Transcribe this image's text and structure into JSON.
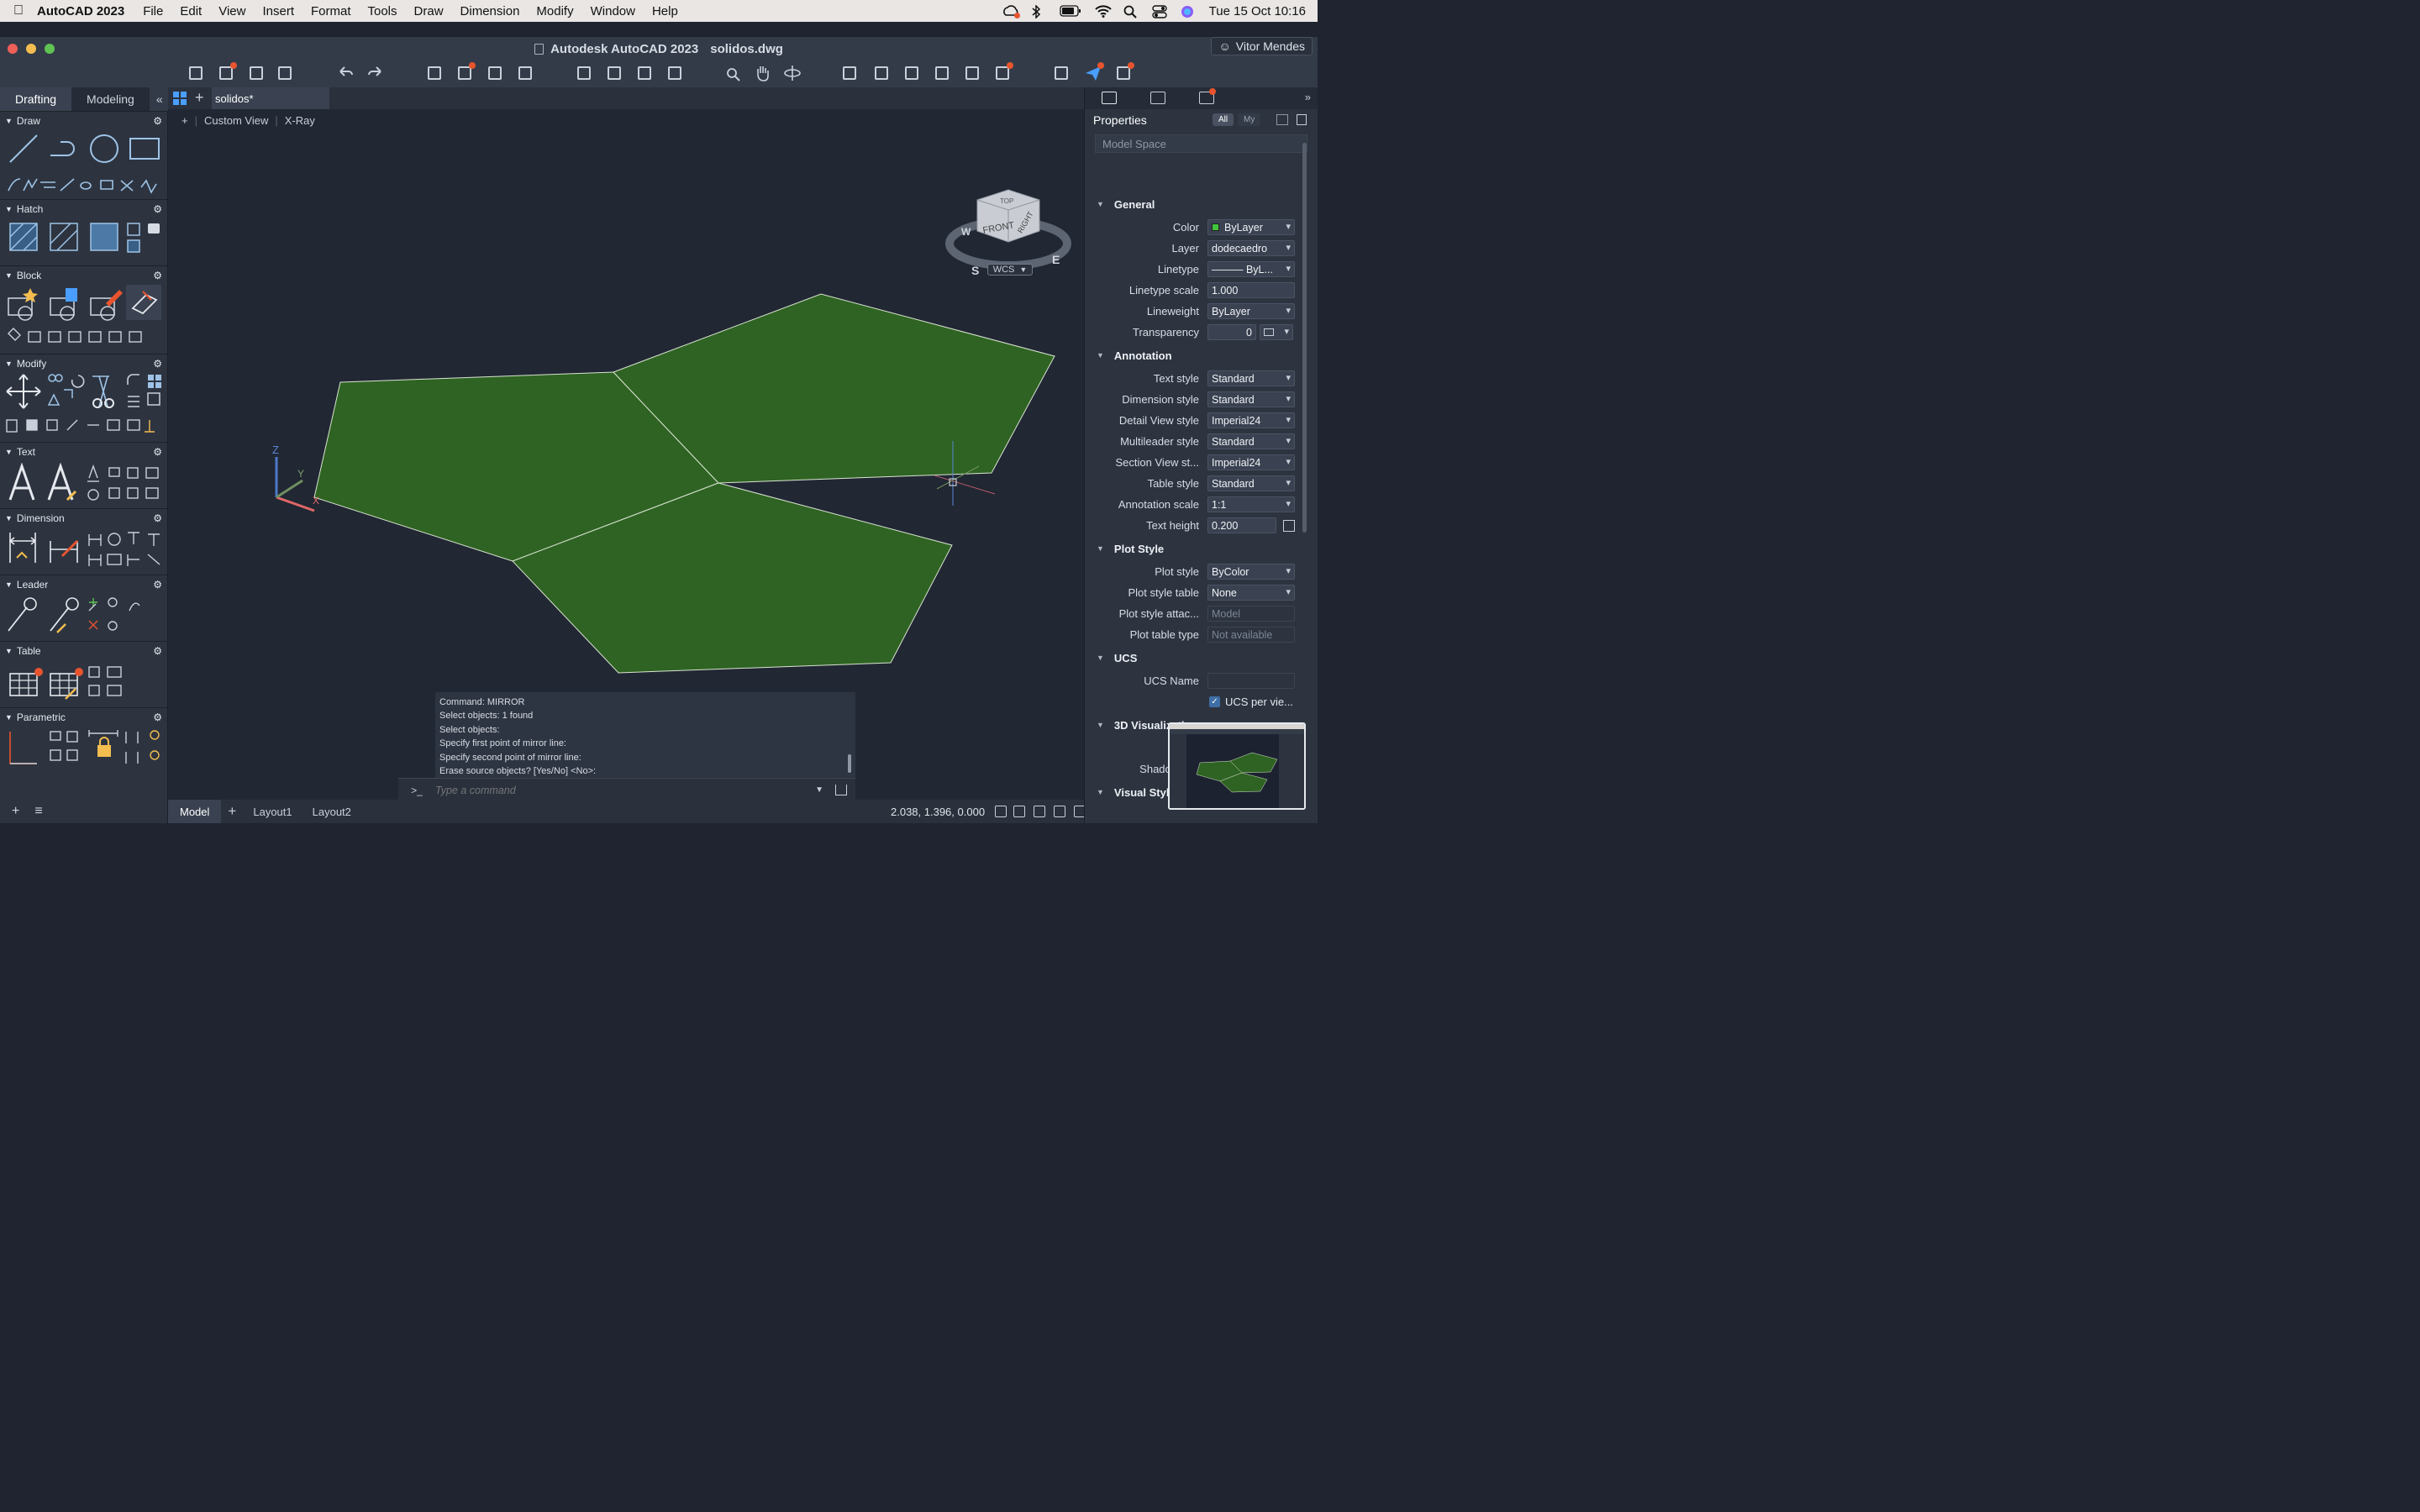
{
  "menubar": {
    "app": "AutoCAD 2023",
    "items": [
      "File",
      "Edit",
      "View",
      "Insert",
      "Format",
      "Tools",
      "Draw",
      "Dimension",
      "Modify",
      "Window",
      "Help"
    ],
    "datetime": "Tue 15 Oct  10:16"
  },
  "window": {
    "title_app": "Autodesk AutoCAD 2023",
    "title_file": "solidos.dwg",
    "user": "Vitor Mendes"
  },
  "palette": {
    "tabs": [
      "Drafting",
      "Modeling"
    ],
    "collapse_glyph": "«",
    "sections": [
      "Draw",
      "Hatch",
      "Block",
      "Modify",
      "Text",
      "Dimension",
      "Leader",
      "Table",
      "Parametric"
    ]
  },
  "viewport": {
    "tab": "solidos*",
    "plus": "+",
    "view_name": "Custom View",
    "visual_style": "X-Ray",
    "viewcube": {
      "top": "TOP",
      "front": "FRONT",
      "right": "RIGHT",
      "w": "W",
      "s": "S",
      "e": "E"
    },
    "wcs": "WCS",
    "axis_labels": {
      "x": "X",
      "y": "Y",
      "z": "Z"
    },
    "solid_color": "#2f6323",
    "edge_color": "#d9e4d2"
  },
  "command": {
    "history": [
      "Command: MIRROR",
      "Select objects: 1 found",
      "Select objects:",
      "Specify first point of mirror line:",
      "Specify second point of mirror line:",
      "Erase source objects? [Yes/No] <No>:"
    ],
    "prompt": ">_",
    "placeholder": "Type a command"
  },
  "statusbar": {
    "layouts": [
      "Model",
      "Layout1",
      "Layout2"
    ],
    "coords": "2.038, 1.396, 0.000"
  },
  "properties": {
    "title": "Properties",
    "filter_all": "All",
    "filter_my": "My",
    "scope": "Model Space",
    "groups": {
      "general": "General",
      "annotation": "Annotation",
      "plot": "Plot Style",
      "ucs": "UCS",
      "viz": "3D Visualization",
      "visual": "Visual Styles"
    },
    "general": {
      "color": {
        "label": "Color",
        "value": "ByLayer"
      },
      "layer": {
        "label": "Layer",
        "value": "dodecaedro"
      },
      "linetype": {
        "label": "Linetype",
        "value": "——— ByL..."
      },
      "linetype_scale": {
        "label": "Linetype scale",
        "value": "1.000"
      },
      "lineweight": {
        "label": "Lineweight",
        "value": "ByLayer"
      },
      "transparency": {
        "label": "Transparency",
        "value": "0"
      }
    },
    "annotation": {
      "text_style": {
        "label": "Text style",
        "value": "Standard"
      },
      "dim_style": {
        "label": "Dimension style",
        "value": "Standard"
      },
      "detail_style": {
        "label": "Detail View style",
        "value": "Imperial24"
      },
      "mleader_style": {
        "label": "Multileader style",
        "value": "Standard"
      },
      "section_style": {
        "label": "Section View st...",
        "value": "Imperial24"
      },
      "table_style": {
        "label": "Table style",
        "value": "Standard"
      },
      "anno_scale": {
        "label": "Annotation scale",
        "value": "1:1"
      },
      "text_height": {
        "label": "Text height",
        "value": "0.200"
      }
    },
    "plot": {
      "plot_style": {
        "label": "Plot style",
        "value": "ByColor"
      },
      "plot_table": {
        "label": "Plot style table",
        "value": "None"
      },
      "plot_attach": {
        "label": "Plot style attac...",
        "value": "Model"
      },
      "plot_type": {
        "label": "Plot table type",
        "value": "Not available"
      }
    },
    "ucs": {
      "name": {
        "label": "UCS Name",
        "value": ""
      },
      "per_viewport": "UCS per vie..."
    },
    "viz": {
      "material": "M...",
      "shadow": "Shadow D..."
    }
  }
}
